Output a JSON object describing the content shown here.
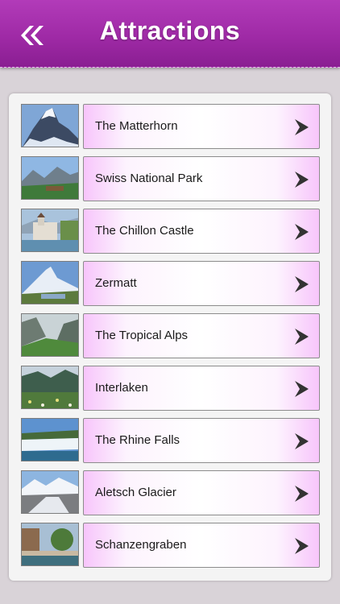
{
  "header": {
    "title": "Attractions",
    "back_icon": "double-chevron-left-icon"
  },
  "colors": {
    "header": "#9f2aa6",
    "button_edge": "#f7c5fb",
    "arrow": "#333333"
  },
  "items": [
    {
      "label": "The Matterhorn"
    },
    {
      "label": "Swiss National Park"
    },
    {
      "label": "The Chillon Castle"
    },
    {
      "label": "Zermatt"
    },
    {
      "label": "The Tropical Alps"
    },
    {
      "label": "Interlaken"
    },
    {
      "label": "The Rhine Falls"
    },
    {
      "label": "Aletsch Glacier"
    },
    {
      "label": "Schanzengraben"
    }
  ]
}
